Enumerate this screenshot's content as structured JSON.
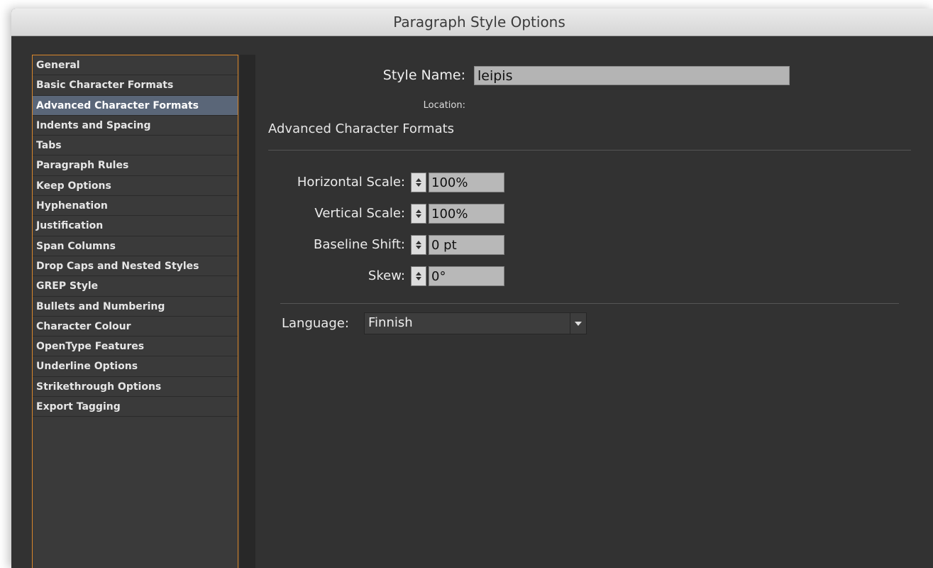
{
  "window": {
    "title": "Paragraph Style Options"
  },
  "sidebar": {
    "selected_index": 2,
    "items": [
      {
        "label": "General"
      },
      {
        "label": "Basic Character Formats"
      },
      {
        "label": "Advanced Character Formats"
      },
      {
        "label": "Indents and Spacing"
      },
      {
        "label": "Tabs"
      },
      {
        "label": "Paragraph Rules"
      },
      {
        "label": "Keep Options"
      },
      {
        "label": "Hyphenation"
      },
      {
        "label": "Justification"
      },
      {
        "label": "Span Columns"
      },
      {
        "label": "Drop Caps and Nested Styles"
      },
      {
        "label": "GREP Style"
      },
      {
        "label": "Bullets and Numbering"
      },
      {
        "label": "Character Colour"
      },
      {
        "label": "OpenType Features"
      },
      {
        "label": "Underline Options"
      },
      {
        "label": "Strikethrough Options"
      },
      {
        "label": "Export Tagging"
      }
    ]
  },
  "header": {
    "style_name_label": "Style Name:",
    "style_name_value": "leipis",
    "location_label": "Location:"
  },
  "section": {
    "heading": "Advanced Character Formats"
  },
  "fields": [
    {
      "label": "Horizontal Scale:",
      "value": "100%"
    },
    {
      "label": "Vertical Scale:",
      "value": "100%"
    },
    {
      "label": "Baseline Shift:",
      "value": "0 pt"
    },
    {
      "label": "Skew:",
      "value": "0°"
    }
  ],
  "language": {
    "label": "Language:",
    "value": "Finnish"
  },
  "colors": {
    "panel_bg": "#323232",
    "sidebar_border": "#d9862a",
    "selection": "#5a6678"
  }
}
